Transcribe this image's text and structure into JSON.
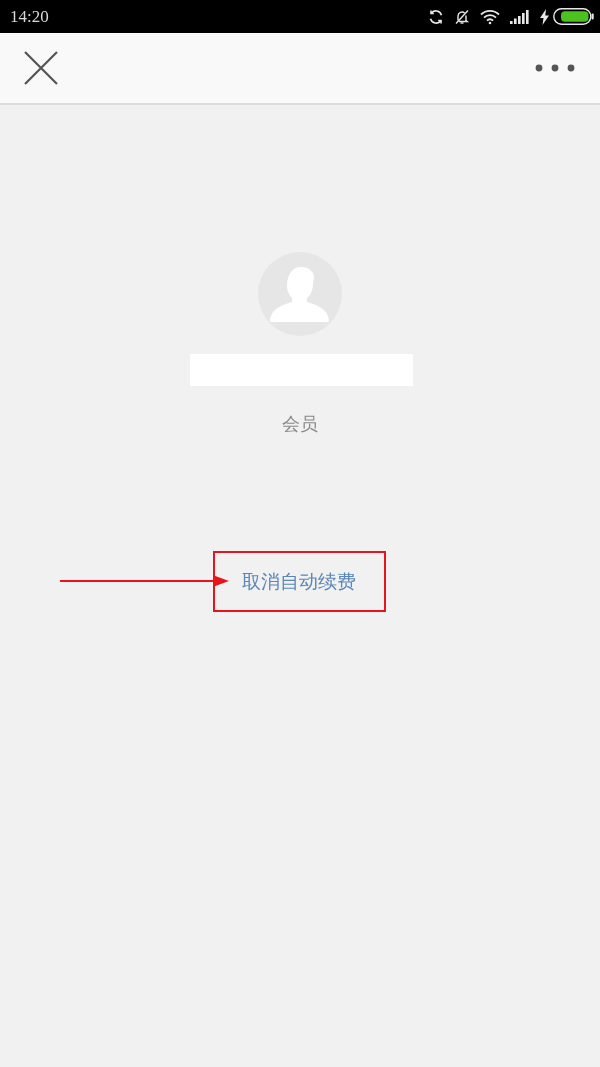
{
  "status_bar": {
    "time": "14:20"
  },
  "profile": {
    "role": "会员"
  },
  "actions": [
    {
      "label": "取消自动续费",
      "highlighted": true
    }
  ]
}
